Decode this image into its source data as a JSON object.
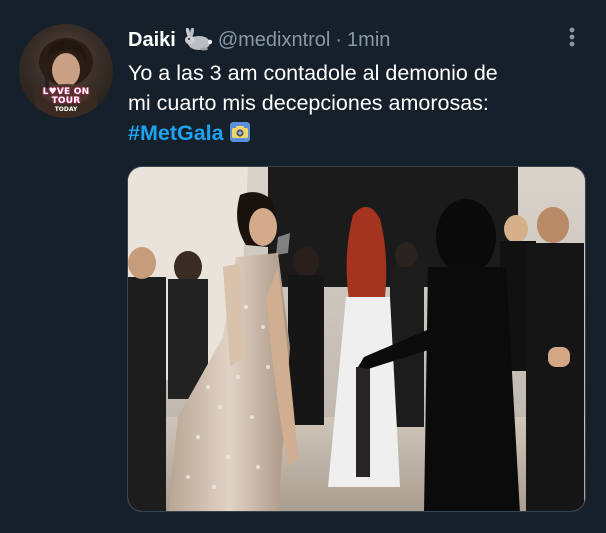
{
  "tweet": {
    "author": {
      "display_name": "Daiki",
      "name_emoji": "rabbit-emoji",
      "handle": "@medixntrol",
      "avatar_badge": [
        "L♥VE ON TOUR",
        "TODAY"
      ]
    },
    "separator": "·",
    "timestamp": "1min",
    "text_lines": [
      "Yo a las 3 am contadole al demonio de",
      "mi cuarto mis decepciones amorosas:"
    ],
    "hashtag": "#MetGala",
    "hashtag_emoji": "camera-emoji",
    "menu_icon": "more-options-icon",
    "media": {
      "kind": "photo",
      "subject": "red-carpet-event"
    }
  },
  "colors": {
    "background": "#15202b",
    "text": "#ffffff",
    "secondary_text": "#8899a6",
    "link": "#1da1f2",
    "border": "#38444d"
  }
}
